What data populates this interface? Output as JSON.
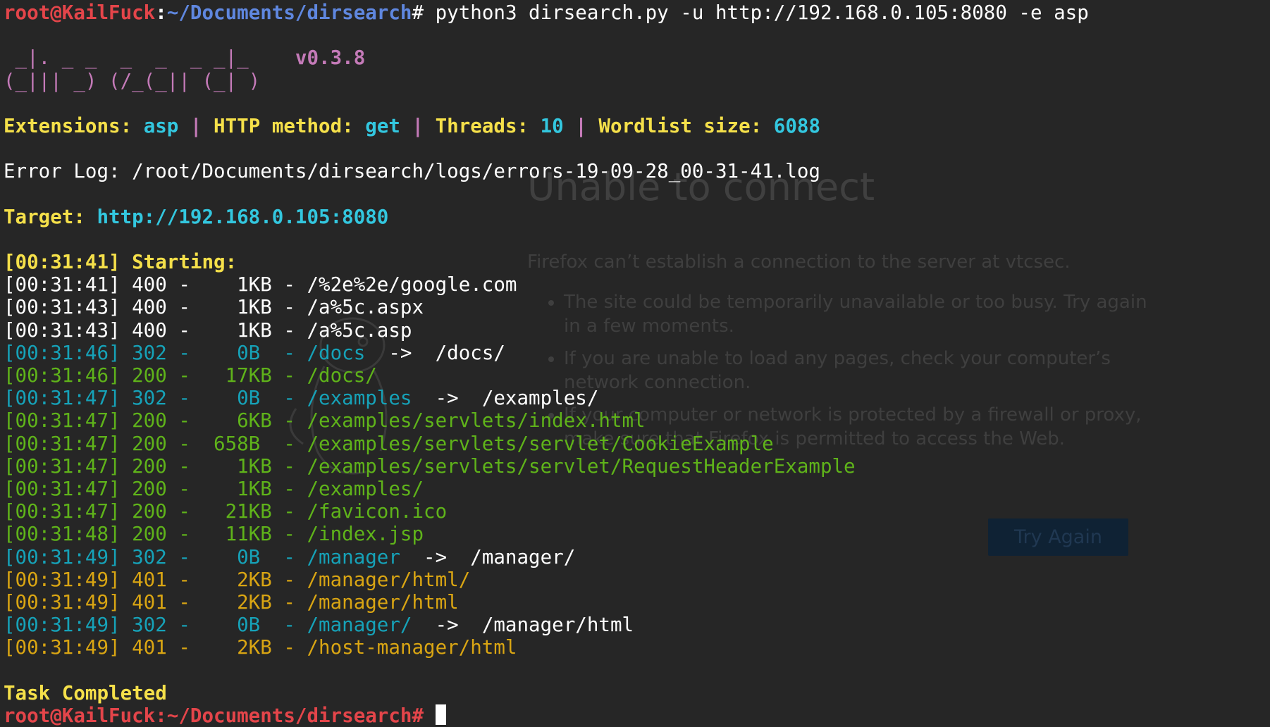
{
  "ghost_page": {
    "title": "Unable to connect",
    "description": "Firefox can’t establish a connection to the server at vtcsec.",
    "bullets": [
      "The site could be temporarily unavailable or too busy. Try again in a few moments.",
      "If you are unable to load any pages, check your computer’s network connection.",
      "If your computer or network is protected by a firewall or proxy, make sure that Firefox is permitted to access the Web."
    ],
    "button": "Try Again"
  },
  "prompt": {
    "user_host": "root@KailFuck",
    "sep": ":",
    "path": "~/Documents/dirsearch",
    "symbol": "# ",
    "command": "python3 dirsearch.py -u http://192.168.0.105:8080 -e asp"
  },
  "banner": {
    "line1": " _|. _ _  _  _  _ _|_    ",
    "version": "v0.3.8",
    "line2": "(_||| _) (/_(_|| (_| )"
  },
  "config": {
    "ext_label": "Extensions: ",
    "ext_value": "asp",
    "sep": " | ",
    "method_label": "HTTP method: ",
    "method_value": "get",
    "threads_label": "Threads: ",
    "threads_value": "10",
    "wordlist_label": "Wordlist size: ",
    "wordlist_value": "6088"
  },
  "error_log": "Error Log: /root/Documents/dirsearch/logs/errors-19-09-28_00-31-41.log",
  "target": {
    "label": "Target: ",
    "url": "http://192.168.0.105:8080"
  },
  "starting": "[00:31:41] Starting:",
  "results": [
    {
      "text": "[00:31:41] 400 -    1KB - /%2e%2e/google.com",
      "status": "400",
      "redirect": ""
    },
    {
      "text": "[00:31:43] 400 -    1KB - /a%5c.aspx",
      "status": "400",
      "redirect": ""
    },
    {
      "text": "[00:31:43] 400 -    1KB - /a%5c.asp",
      "status": "400",
      "redirect": ""
    },
    {
      "text": "[00:31:46] 302 -    0B  - /docs",
      "status": "302",
      "redirect": "  ->  /docs/"
    },
    {
      "text": "[00:31:46] 200 -   17KB - /docs/",
      "status": "200",
      "redirect": ""
    },
    {
      "text": "[00:31:47] 302 -    0B  - /examples",
      "status": "302",
      "redirect": "  ->  /examples/"
    },
    {
      "text": "[00:31:47] 200 -    6KB - /examples/servlets/index.html",
      "status": "200",
      "redirect": ""
    },
    {
      "text": "[00:31:47] 200 -  658B  - /examples/servlets/servlet/CookieExample",
      "status": "200",
      "redirect": ""
    },
    {
      "text": "[00:31:47] 200 -    1KB - /examples/servlets/servlet/RequestHeaderExample",
      "status": "200",
      "redirect": ""
    },
    {
      "text": "[00:31:47] 200 -    1KB - /examples/",
      "status": "200",
      "redirect": ""
    },
    {
      "text": "[00:31:47] 200 -   21KB - /favicon.ico",
      "status": "200",
      "redirect": ""
    },
    {
      "text": "[00:31:48] 200 -   11KB - /index.jsp",
      "status": "200",
      "redirect": ""
    },
    {
      "text": "[00:31:49] 302 -    0B  - /manager",
      "status": "302",
      "redirect": "  ->  /manager/"
    },
    {
      "text": "[00:31:49] 401 -    2KB - /manager/html/",
      "status": "401",
      "redirect": ""
    },
    {
      "text": "[00:31:49] 401 -    2KB - /manager/html",
      "status": "401",
      "redirect": ""
    },
    {
      "text": "[00:31:49] 302 -    0B  - /manager/",
      "status": "302",
      "redirect": "  ->  /manager/html"
    },
    {
      "text": "[00:31:49] 401 -    2KB - /host-manager/html",
      "status": "401",
      "redirect": ""
    }
  ],
  "completed": "Task Completed",
  "next_prompt": "root@KailFuck:~/Documents/dirsearch# ",
  "colors": {
    "background": "#262626",
    "status_200": "#5fb31a",
    "status_302": "#16a2b8",
    "status_401": "#d9a513",
    "highlight": "#f5e04a",
    "accent": "#33c7df",
    "user": "#e4454a",
    "path": "#5f87df"
  }
}
